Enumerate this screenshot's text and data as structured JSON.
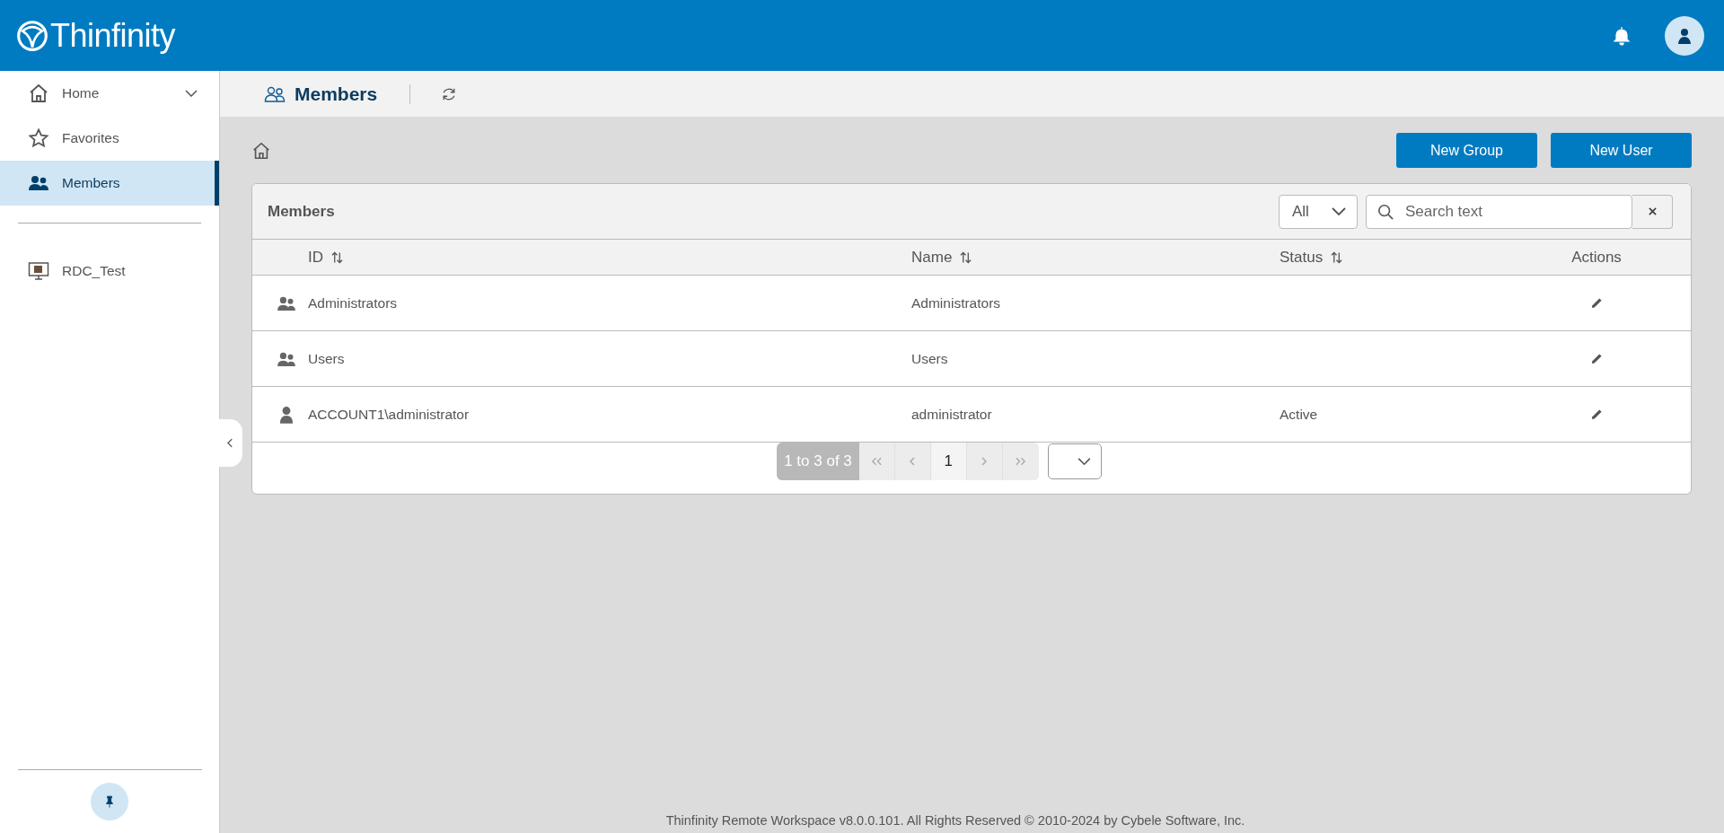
{
  "header": {
    "brand": "Thinfinity"
  },
  "sidebar": {
    "items": [
      {
        "label": "Home",
        "selected": false,
        "expanded": false
      },
      {
        "label": "Favorites",
        "selected": false
      },
      {
        "label": "Members",
        "selected": true
      }
    ],
    "connections": [
      {
        "label": "RDC_Test",
        "selected": false
      }
    ]
  },
  "page": {
    "title": "Members"
  },
  "actions": [
    "New Group",
    "New User"
  ],
  "card": {
    "title": "Members",
    "filter": {
      "value": "All"
    },
    "search": {
      "placeholder": "Search text"
    }
  },
  "table": {
    "columns": [
      {
        "label": "ID",
        "sortable": true
      },
      {
        "label": "Name",
        "sortable": true
      },
      {
        "label": "Status",
        "sortable": true
      },
      {
        "label": "Actions",
        "sortable": false
      }
    ],
    "rows": [
      {
        "kind": "group",
        "id": "Administrators",
        "name": "Administrators"
      },
      {
        "kind": "group",
        "id": "Users",
        "name": "Users"
      },
      {
        "kind": "user",
        "id": "ACCOUNT1\\administrator",
        "name": "administrator",
        "status": "Active"
      }
    ]
  },
  "pagination": {
    "summary": "1 to 3 of 3",
    "pages": [
      {
        "label": "1",
        "selected": true
      }
    ],
    "first_disabled": true,
    "last_disabled": true
  },
  "footer": "Thinfinity Remote Workspace v8.0.0.101. All Rights Reserved © 2010-2024 by Cybele Software, Inc."
}
